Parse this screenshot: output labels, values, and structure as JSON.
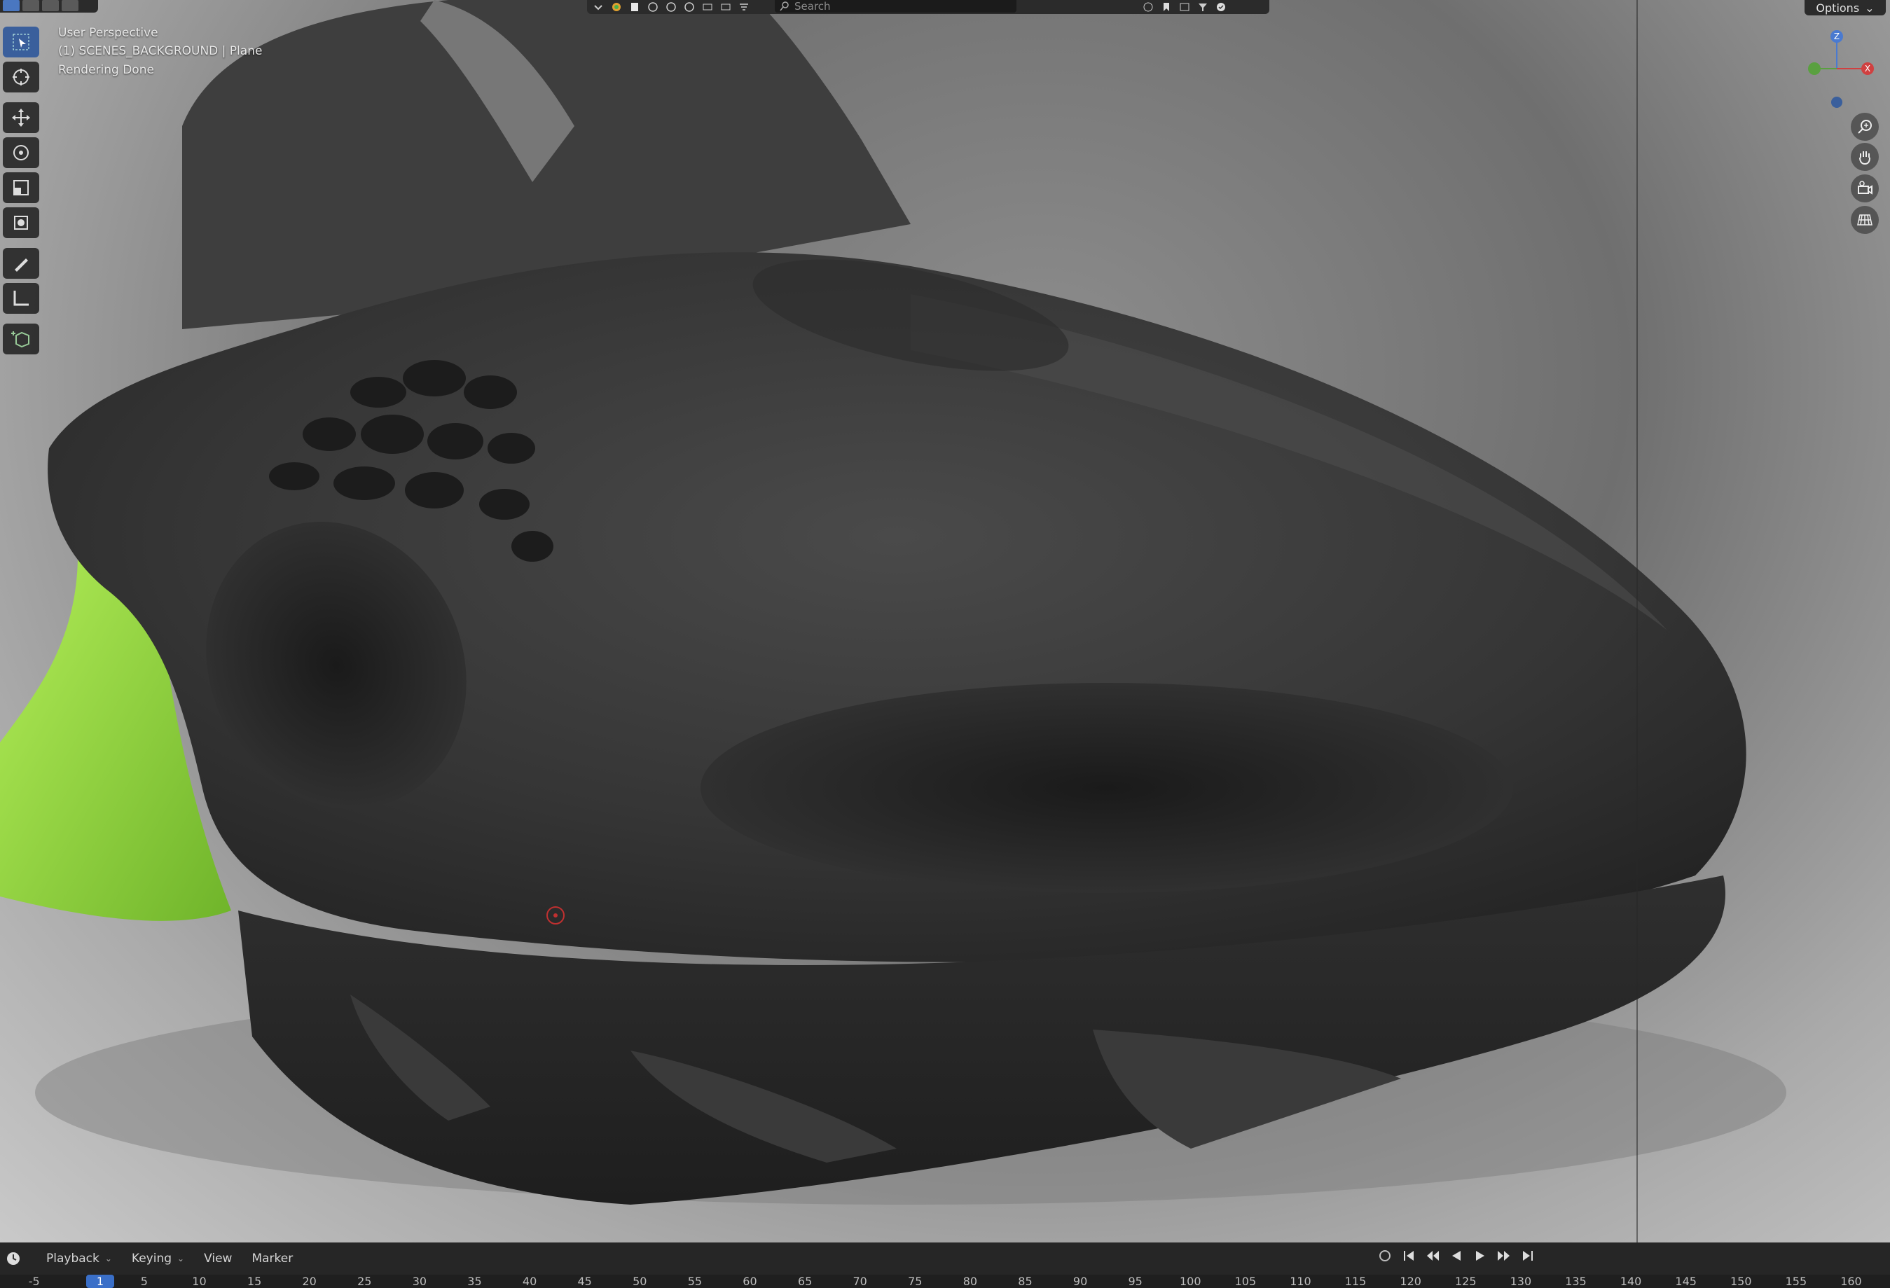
{
  "viewport": {
    "view_name": "User Perspective",
    "scene_info": "(1) SCENES_BACKGROUND | Plane",
    "status": "Rendering Done"
  },
  "header": {
    "search_placeholder": "Search",
    "options_label": "Options"
  },
  "gizmo": {
    "z_label": "Z",
    "x_label": "X"
  },
  "timeline": {
    "menus": [
      "Playback",
      "Keying",
      "View",
      "Marker"
    ],
    "current_frame": "1",
    "ruler_ticks": [
      "-5",
      "5",
      "10",
      "15",
      "20",
      "25",
      "30",
      "35",
      "40",
      "45",
      "50",
      "55",
      "60",
      "65",
      "70",
      "75",
      "80",
      "85",
      "90",
      "95",
      "100",
      "105",
      "110",
      "115",
      "120",
      "125",
      "130",
      "135",
      "140",
      "145",
      "150",
      "155",
      "160"
    ]
  },
  "toolbar": {
    "tools": [
      "select-box",
      "cursor",
      "move",
      "rotate",
      "scale",
      "transform",
      "annotate",
      "measure",
      "add-cube"
    ],
    "active_tool": "select-box"
  },
  "colors": {
    "accent": "#3a6fc8",
    "shoe_body": "#3a3a3a",
    "sole_accent": "#8fd43a"
  }
}
